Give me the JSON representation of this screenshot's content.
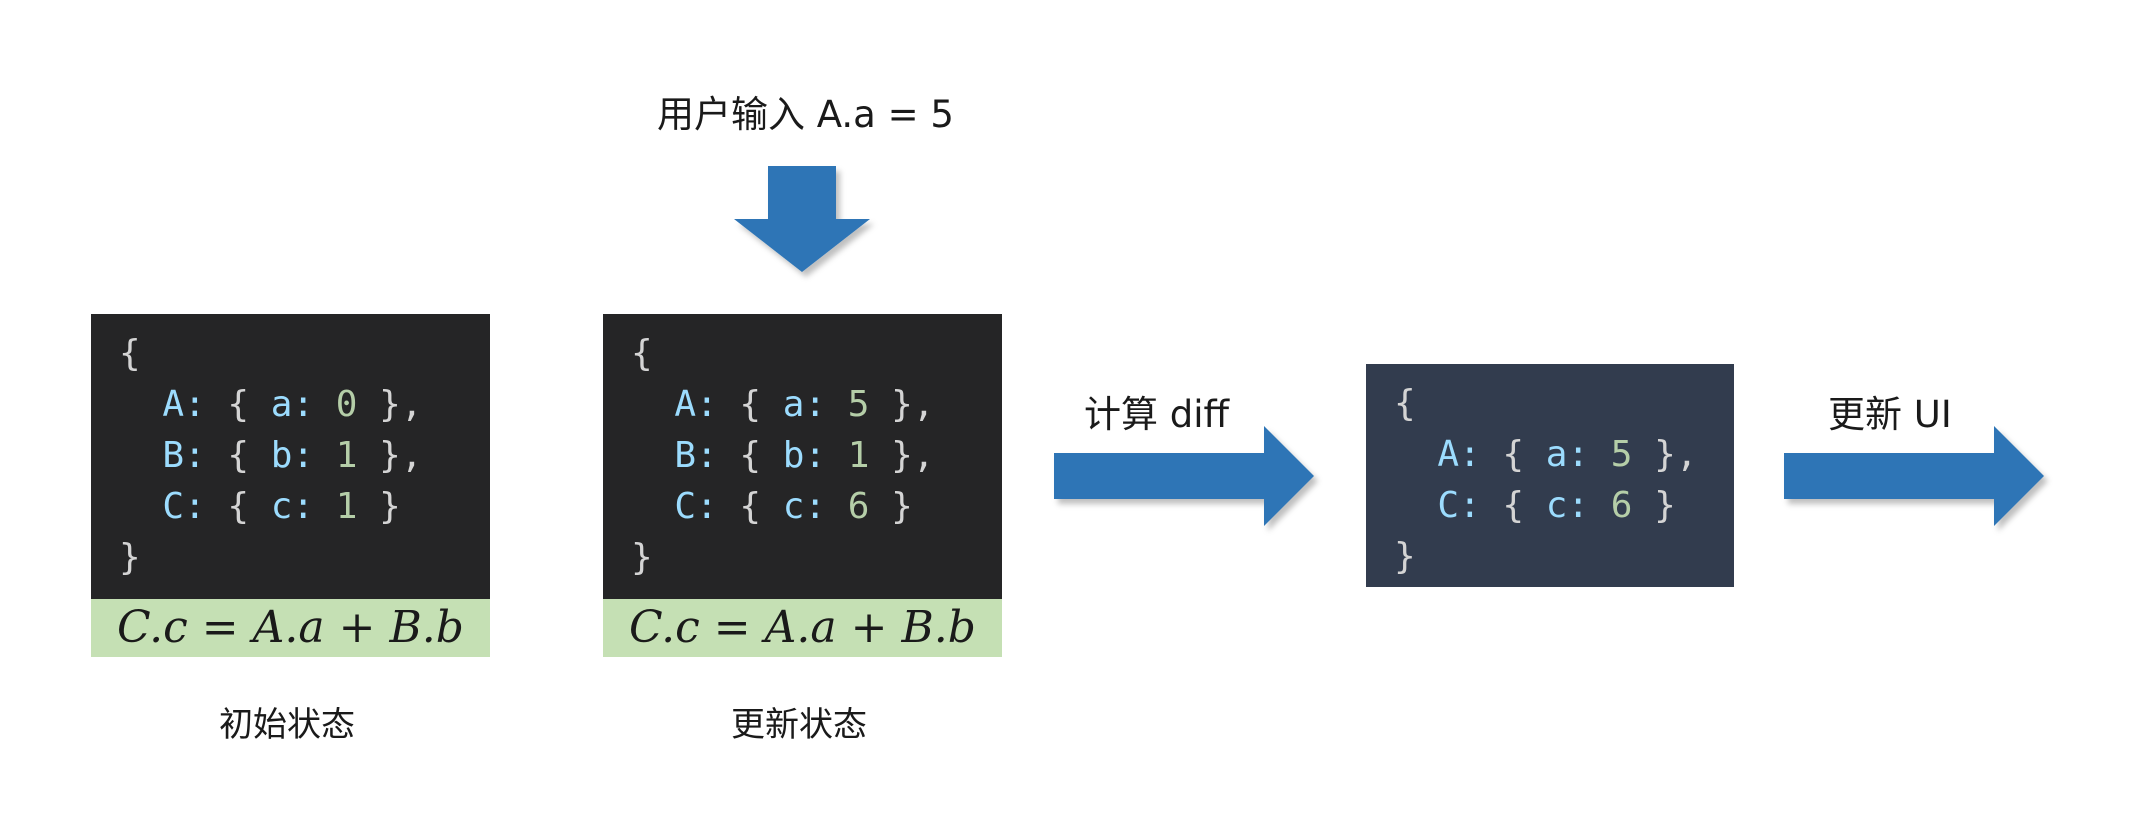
{
  "top_input_label": "用户输入 A.a = 5",
  "compute_diff_label": "计算 diff",
  "update_ui_label": "更新 UI",
  "colors": {
    "arrow": "#2e75b6",
    "code_bg_dark": "#252526",
    "code_bg_slate": "#323c4e",
    "formula_bg": "#c5e0b4",
    "key_color": "#9cdcfe",
    "number_color": "#b5cea8"
  },
  "initial_state": {
    "caption": "初始状态",
    "formula": "C.c = A.a + B.b",
    "lines": [
      {
        "text": "{"
      },
      {
        "key": "A",
        "field": "a",
        "value": "0",
        "suffix": " },"
      },
      {
        "key": "B",
        "field": "b",
        "value": "1",
        "suffix": " },"
      },
      {
        "key": "C",
        "field": "c",
        "value": "1",
        "suffix": " }"
      },
      {
        "text": "}"
      }
    ]
  },
  "updated_state": {
    "caption": "更新状态",
    "formula": "C.c = A.a + B.b",
    "lines": [
      {
        "text": "{"
      },
      {
        "key": "A",
        "field": "a",
        "value": "5",
        "suffix": " },"
      },
      {
        "key": "B",
        "field": "b",
        "value": "1",
        "suffix": " },"
      },
      {
        "key": "C",
        "field": "c",
        "value": "6",
        "suffix": " }"
      },
      {
        "text": "}"
      }
    ]
  },
  "diff_state": {
    "lines": [
      {
        "text": "{"
      },
      {
        "key": "A",
        "field": "a",
        "value": "5",
        "suffix": " },"
      },
      {
        "key": "C",
        "field": "c",
        "value": "6",
        "suffix": " }"
      },
      {
        "text": "}"
      }
    ]
  }
}
